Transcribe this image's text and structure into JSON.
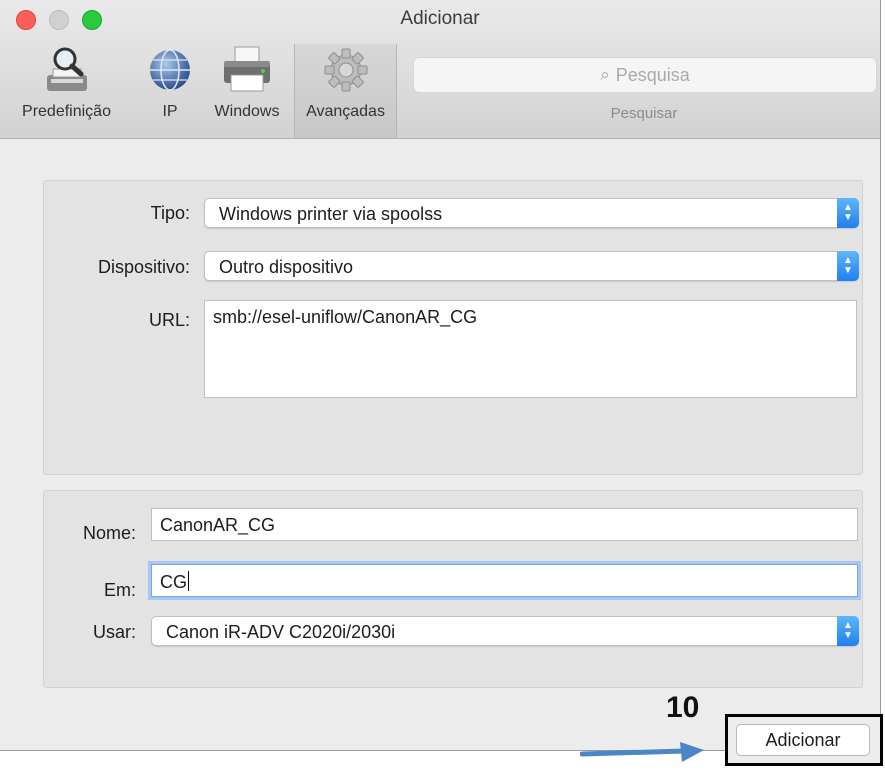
{
  "window": {
    "title": "Adicionar"
  },
  "toolbar": {
    "items": [
      {
        "label": "Predefinição",
        "icon": "magnifier-printer-icon",
        "selected": false
      },
      {
        "label": "IP",
        "icon": "globe-icon",
        "selected": false
      },
      {
        "label": "Windows",
        "icon": "printer-icon",
        "selected": false
      },
      {
        "label": "Avançadas",
        "icon": "gear-icon",
        "selected": true
      }
    ],
    "search": {
      "placeholder": "Pesquisa",
      "caption": "Pesquisar"
    }
  },
  "advanced": {
    "tipo_label": "Tipo:",
    "tipo_value": "Windows printer via spoolss",
    "dispositivo_label": "Dispositivo:",
    "dispositivo_value": "Outro dispositivo",
    "url_label": "URL:",
    "url_value": "smb://esel-uniflow/CanonAR_CG"
  },
  "details": {
    "nome_label": "Nome:",
    "nome_value": "CanonAR_CG",
    "em_label": "Em:",
    "em_value": "CG",
    "usar_label": "Usar:",
    "usar_value": "Canon iR-ADV C2020i/2030i"
  },
  "annotation": {
    "step_number": "10"
  },
  "footer": {
    "add_button": "Adicionar"
  },
  "colors": {
    "accent": "#1f7ff0",
    "focus_ring": "#a6c8f3",
    "arrow": "#4a86c8"
  }
}
